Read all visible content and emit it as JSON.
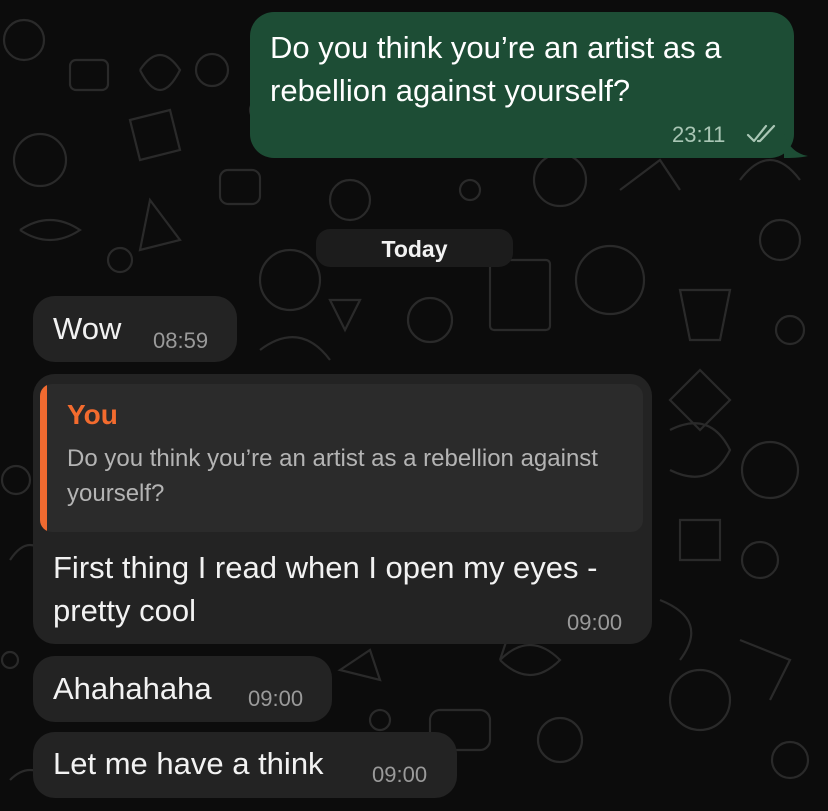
{
  "date_divider": "Today",
  "messages": [
    {
      "direction": "outgoing",
      "text": "Do you think you’re an artist as a rebellion against yourself?",
      "time": "23:11",
      "status_icon": "double-check-icon"
    },
    {
      "direction": "incoming",
      "text": "Wow",
      "time": "08:59"
    },
    {
      "direction": "incoming",
      "reply_to": {
        "author": "You",
        "text": "Do you think you’re an artist as a rebellion against yourself?"
      },
      "text": "First thing I read when I open my eyes - pretty cool",
      "time": "09:00"
    },
    {
      "direction": "incoming",
      "text": "Ahahahaha",
      "time": "09:00"
    },
    {
      "direction": "incoming",
      "text": "Let me have a think",
      "time": "09:00"
    }
  ],
  "colors": {
    "outgoing_bubble": "#1d4d35",
    "incoming_bubble": "#232323",
    "quote_accent": "#f06a30",
    "background": "#0c0c0c"
  }
}
